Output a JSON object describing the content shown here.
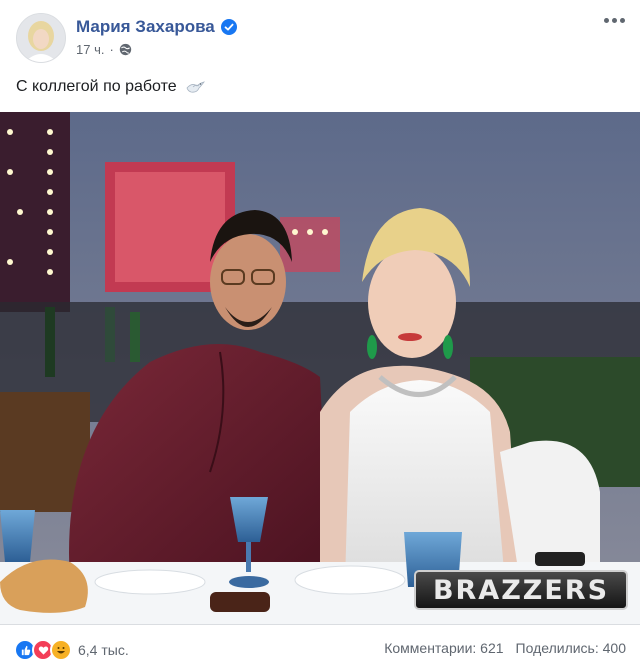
{
  "post": {
    "author": "Мария Захарова",
    "time": "17 ч.",
    "separator": "·",
    "text": "С коллегой по работе"
  },
  "icons": {
    "verified": "verified-badge-icon",
    "privacy": "globe-icon",
    "more": "more-options-icon",
    "dove": "dove-emoji-icon",
    "reactions": [
      "like-icon",
      "love-icon",
      "haha-icon"
    ]
  },
  "photo": {
    "watermark": "BRAZZERS"
  },
  "footer": {
    "reactions_count": "6,4 тыс.",
    "comments": "Комментарии: 621",
    "shares": "Поделились: 400"
  },
  "colors": {
    "author_link": "#385898",
    "verified": "#1877f2",
    "secondary_text": "#606770",
    "like": "#1877f2",
    "love": "#f33e58",
    "haha": "#f7b125"
  }
}
